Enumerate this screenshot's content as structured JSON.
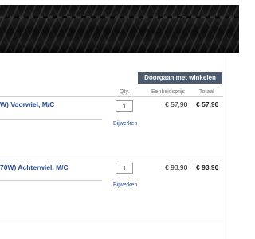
{
  "banner": {
    "image": "tire-tread-banner"
  },
  "cart": {
    "continue_label": "Doorgaan met winkelen",
    "headers": {
      "qty": "Qty.",
      "unit_price": "Eenheidsprijs",
      "total": "Totaal"
    },
    "items": [
      {
        "name": "W) Voorwiel, M/C",
        "quantity": "1",
        "unit_price": "€ 57,90",
        "total": "€ 57,90",
        "update_label": "Bijwerken"
      },
      {
        "name": "70W) Achterwiel, M/C",
        "quantity": "1",
        "unit_price": "€ 93,90",
        "total": "€ 93,90",
        "update_label": "Bijwerken"
      }
    ]
  }
}
